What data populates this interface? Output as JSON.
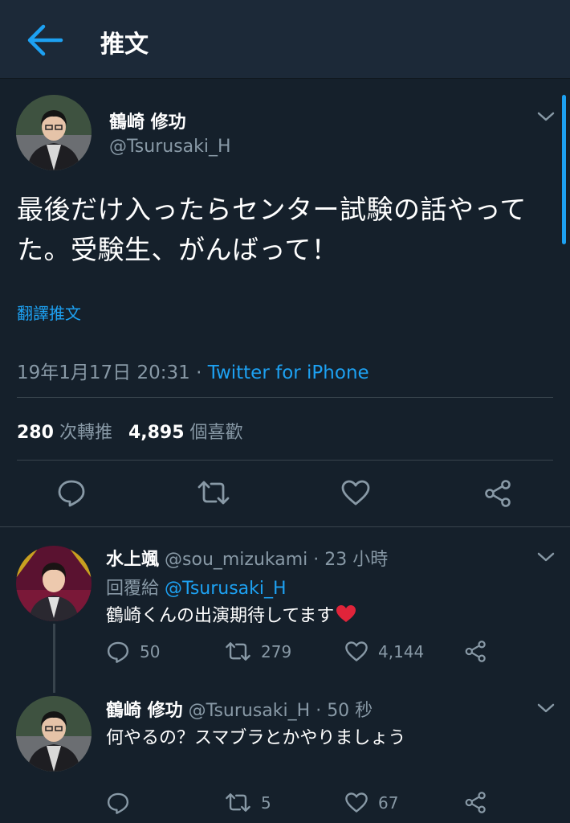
{
  "header": {
    "title": "推文"
  },
  "tweet": {
    "name": "鶴崎 修功",
    "handle": "@Tsurusaki_H",
    "text_line1": "最後だけ入ったらセンター試験の話やって",
    "text_line2": "た。受験生、がんばって！",
    "translate": "翻譯推文",
    "timestamp": "19年1月17日 20:31",
    "separator": " · ",
    "source": "Twitter for iPhone",
    "retweets_count": "280",
    "retweets_label": "次轉推",
    "likes_count": "4,895",
    "likes_label": "個喜歡"
  },
  "replies": [
    {
      "name": "水上颯",
      "handle": "@sou_mizukami",
      "time": "23 小時",
      "reply_to_label": "回覆給",
      "reply_to": "@Tsurusaki_H",
      "text": "鶴崎くんの出演期待してます",
      "reply_count": "50",
      "retweet_count": "279",
      "like_count": "4,144"
    },
    {
      "name": "鶴崎 修功",
      "handle": "@Tsurusaki_H",
      "time": "50 秒",
      "text": "何やるの？スマブラとかやりましょう",
      "reply_count": "",
      "retweet_count": "5",
      "like_count": "67"
    }
  ],
  "colors": {
    "background": "#15202b",
    "header": "#1c2938",
    "accent": "#1da1f2",
    "secondary_text": "#8899a6",
    "divider": "#38444d"
  },
  "icons": [
    "back-arrow-icon",
    "chevron-down-icon",
    "reply-icon",
    "retweet-icon",
    "like-icon",
    "share-icon",
    "red-heart-emoji"
  ]
}
